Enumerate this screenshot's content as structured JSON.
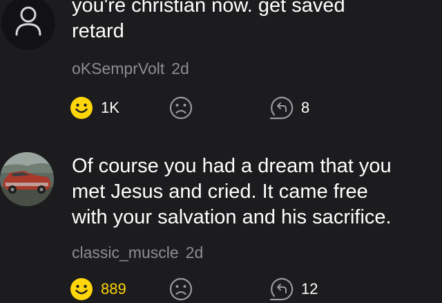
{
  "comments": [
    {
      "text": "you're christian now. get saved\nretard",
      "author": "oKSemprVolt",
      "age": "2d",
      "reactions": "1K",
      "replies": "8",
      "avatar": "default-user-icon"
    },
    {
      "text": "Of course you had a dream that you\nmet Jesus and cried. It came free\nwith your salvation and his sacrifice.",
      "author": "classic_muscle",
      "age": "2d",
      "reactions": "889",
      "replies": "12",
      "avatar": "red-muscle-car-photo"
    }
  ],
  "colors": {
    "background": "#1c1c1e",
    "meta_text": "#8e8e93",
    "smiley_active": "#ffd60a",
    "icon_gray": "#9a9a9e"
  },
  "icons": [
    "smiley-reaction-icon",
    "sad-face-icon",
    "reply-icon",
    "user-icon"
  ]
}
